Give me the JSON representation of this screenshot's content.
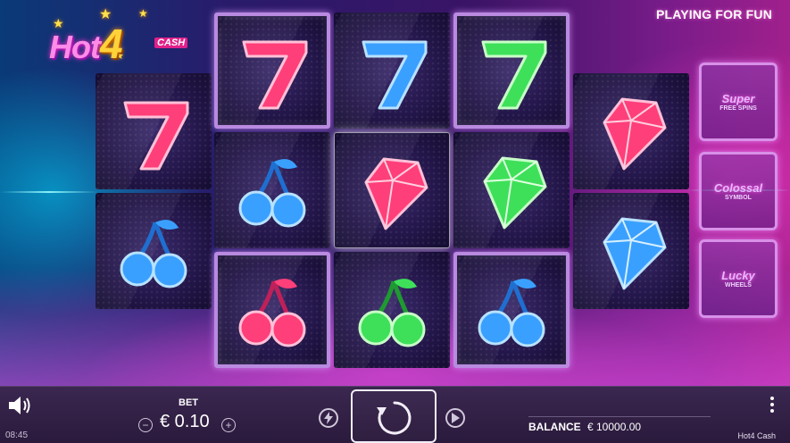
{
  "game": {
    "logo_main": "Hot",
    "logo_four": "4",
    "logo_cash": "CASH",
    "mode_label": "PLAYING FOR FUN",
    "name": "Hot4 Cash"
  },
  "reels": [
    [
      "seven-red",
      "cherry-blue"
    ],
    [
      "seven-red",
      "cherry-blue",
      "cherry-red"
    ],
    [
      "seven-blue",
      "diamond-red",
      "cherry-green"
    ],
    [
      "seven-green",
      "diamond-green",
      "cherry-blue"
    ],
    [
      "diamond-red",
      "diamond-blue"
    ]
  ],
  "features": [
    {
      "title": "Super",
      "subtitle": "FREE SPINS"
    },
    {
      "title": "Colossal",
      "subtitle": "SYMBOL"
    },
    {
      "title": "Lucky",
      "subtitle": "WHEELS"
    }
  ],
  "bottom_bar": {
    "bet_label": "BET",
    "bet_value": "€ 0.10",
    "decrease_symbol": "⊖",
    "increase_symbol": "⊕",
    "balance_label": "BALANCE",
    "balance_value": "€ 10000.00",
    "time": "08:45",
    "icons": {
      "sound": "speaker-icon",
      "turbo": "lightning-icon",
      "spin": "spin-arrow-icon",
      "autoplay": "play-icon",
      "menu": "more-vertical-icon"
    }
  },
  "colors": {
    "red": "#ff3f7a",
    "blue": "#3aa0ff",
    "green": "#3ee05a",
    "frame": "#b98ae0",
    "bar": "#2f1f42"
  }
}
